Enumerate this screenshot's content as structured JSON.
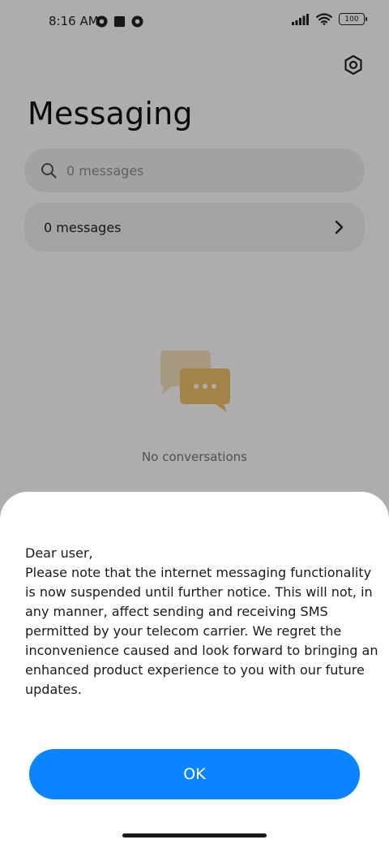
{
  "status_bar": {
    "time": "8:16 AM",
    "battery": "100"
  },
  "header": {
    "title": "Messaging",
    "settings_icon": "gear-icon"
  },
  "search": {
    "placeholder": "0 messages",
    "icon": "search-icon"
  },
  "messages_row": {
    "label": "0 messages",
    "icon": "chevron-right-icon"
  },
  "empty_state": {
    "text": "No conversations",
    "icon": "chat-bubbles-icon",
    "accent_color": "#f2c16b"
  },
  "dialog": {
    "greeting": "Dear user,",
    "body": "Please note that the internet messaging functionality is now suspended until further notice. This will not, in any manner, affect sending and receiving SMS permitted by your telecom carrier. We regret the inconvenience caused and look forward to bringing an enhanced product experience to you with our future updates.",
    "ok_label": "OK",
    "button_color": "#0d84ff"
  }
}
